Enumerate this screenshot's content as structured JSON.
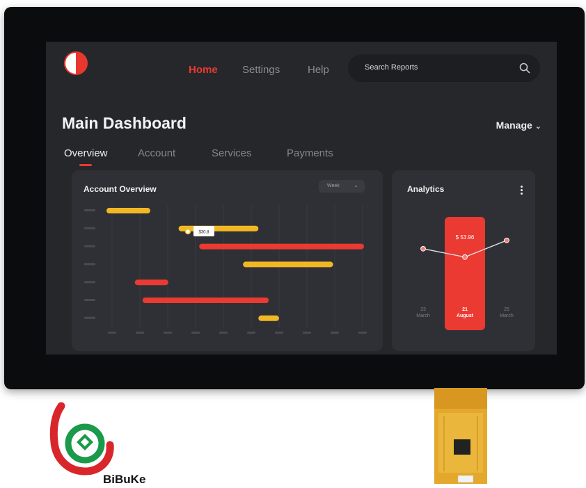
{
  "nav": {
    "links": [
      "Home",
      "Settings",
      "Help"
    ],
    "active": "Home",
    "search_placeholder": "Search Reports"
  },
  "header": {
    "title": "Main Dashboard",
    "manage_label": "Manage"
  },
  "tabs": [
    "Overview",
    "Account",
    "Services",
    "Payments"
  ],
  "account_overview": {
    "title": "Account Overview",
    "period_select": "Week",
    "tooltip_value": "$30.8"
  },
  "analytics": {
    "title": "Analytics",
    "highlight_value": "$ 53.96",
    "dates": [
      {
        "day": "23",
        "month": "March"
      },
      {
        "day": "21",
        "month": "August"
      },
      {
        "day": "25",
        "month": "March"
      }
    ]
  },
  "brand": {
    "name": "BiBuKe"
  },
  "colors": {
    "accent_red": "#ea3a31",
    "accent_yellow": "#f2b824",
    "screen_bg": "#26272b",
    "card_bg": "#2f3035"
  },
  "chart_data": [
    {
      "type": "bar",
      "orientation": "horizontal-range",
      "title": "Account Overview",
      "series": [
        {
          "color": "yellow",
          "start": 0.0,
          "end": 0.17
        },
        {
          "color": "yellow",
          "start": 0.28,
          "end": 0.59
        },
        {
          "color": "red",
          "start": 0.36,
          "end": 1.0
        },
        {
          "color": "yellow",
          "start": 0.53,
          "end": 0.88
        },
        {
          "color": "red",
          "start": 0.11,
          "end": 0.24
        },
        {
          "color": "red",
          "start": 0.14,
          "end": 0.63
        },
        {
          "color": "yellow",
          "start": 0.59,
          "end": 0.67
        }
      ],
      "grid": true
    },
    {
      "type": "line",
      "title": "Analytics",
      "x": [
        "23 March",
        "21 August",
        "25 March"
      ],
      "values": [
        0.62,
        0.42,
        0.82
      ],
      "highlighted_index": 1,
      "highlight_label": "$ 53.96"
    }
  ]
}
